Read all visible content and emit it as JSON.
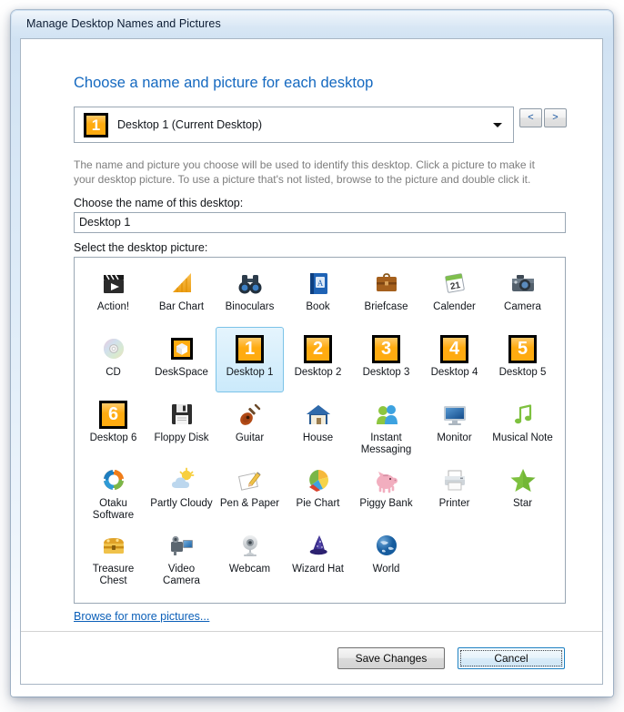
{
  "window": {
    "title": "Manage Desktop Names and Pictures"
  },
  "heading": "Choose a name and picture for each desktop",
  "desktop_selector": {
    "selected_label": "Desktop 1 (Current Desktop)",
    "selected_number": "1",
    "dropdown_icon": "chevron-down-icon",
    "prev_label": "<",
    "next_label": ">"
  },
  "description": "The name and picture you choose will be used to identify this desktop. Click a picture to make it your desktop picture. To use a picture that's not listed, browse to the picture and double click it.",
  "name_field": {
    "label": "Choose the name of this desktop:",
    "value": "Desktop 1",
    "placeholder": ""
  },
  "picture_list": {
    "label": "Select the desktop picture:",
    "selected_index": 9,
    "items": [
      {
        "label": "Action!",
        "icon": "clapperboard-icon"
      },
      {
        "label": "Bar Chart",
        "icon": "bar-chart-icon"
      },
      {
        "label": "Binoculars",
        "icon": "binoculars-icon"
      },
      {
        "label": "Book",
        "icon": "book-icon"
      },
      {
        "label": "Briefcase",
        "icon": "briefcase-icon"
      },
      {
        "label": "Calender",
        "icon": "calendar-icon"
      },
      {
        "label": "Camera",
        "icon": "camera-icon"
      },
      {
        "label": "CD",
        "icon": "cd-icon"
      },
      {
        "label": "DeskSpace",
        "icon": "deskspace-cube-icon"
      },
      {
        "label": "Desktop 1",
        "icon": "number-tile-icon",
        "number": "1"
      },
      {
        "label": "Desktop 2",
        "icon": "number-tile-icon",
        "number": "2"
      },
      {
        "label": "Desktop 3",
        "icon": "number-tile-icon",
        "number": "3"
      },
      {
        "label": "Desktop 4",
        "icon": "number-tile-icon",
        "number": "4"
      },
      {
        "label": "Desktop 5",
        "icon": "number-tile-icon",
        "number": "5"
      },
      {
        "label": "Desktop 6",
        "icon": "number-tile-icon",
        "number": "6"
      },
      {
        "label": "Floppy Disk",
        "icon": "floppy-disk-icon"
      },
      {
        "label": "Guitar",
        "icon": "guitar-icon"
      },
      {
        "label": "House",
        "icon": "house-icon"
      },
      {
        "label": "Instant Messaging",
        "icon": "instant-messaging-icon"
      },
      {
        "label": "Monitor",
        "icon": "monitor-icon"
      },
      {
        "label": "Musical Note",
        "icon": "musical-note-icon"
      },
      {
        "label": "Otaku Software",
        "icon": "otaku-gear-icon"
      },
      {
        "label": "Partly Cloudy",
        "icon": "partly-cloudy-icon"
      },
      {
        "label": "Pen & Paper",
        "icon": "pen-paper-icon"
      },
      {
        "label": "Pie Chart",
        "icon": "pie-chart-icon"
      },
      {
        "label": "Piggy Bank",
        "icon": "piggy-bank-icon"
      },
      {
        "label": "Printer",
        "icon": "printer-icon"
      },
      {
        "label": "Star",
        "icon": "star-icon"
      },
      {
        "label": "Treasure Chest",
        "icon": "treasure-chest-icon"
      },
      {
        "label": "Video Camera",
        "icon": "video-camera-icon"
      },
      {
        "label": "Webcam",
        "icon": "webcam-icon"
      },
      {
        "label": "Wizard Hat",
        "icon": "wizard-hat-icon"
      },
      {
        "label": "World",
        "icon": "world-globe-icon"
      }
    ]
  },
  "browse_link": "Browse for more pictures...",
  "buttons": {
    "save": "Save Changes",
    "cancel": "Cancel",
    "focused": "Cancel"
  },
  "colors": {
    "heading_blue": "#1569c0",
    "link_blue": "#0b5fb8",
    "tile_orange": "#ffab10",
    "selection_blue": "#7bc3e8",
    "description_gray": "#7d7d7d"
  }
}
